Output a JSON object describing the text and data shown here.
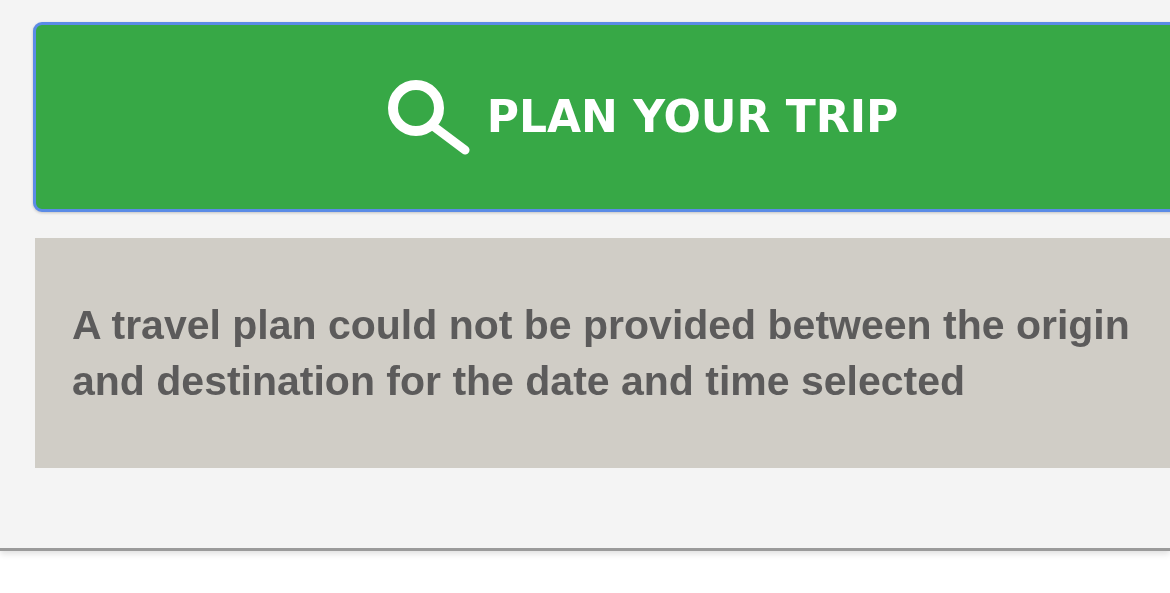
{
  "plan_button": {
    "label": "PLAN YOUR TRIP",
    "focused": true
  },
  "message": "A travel plan could not be provided between the origin and destination for the date and time selected"
}
